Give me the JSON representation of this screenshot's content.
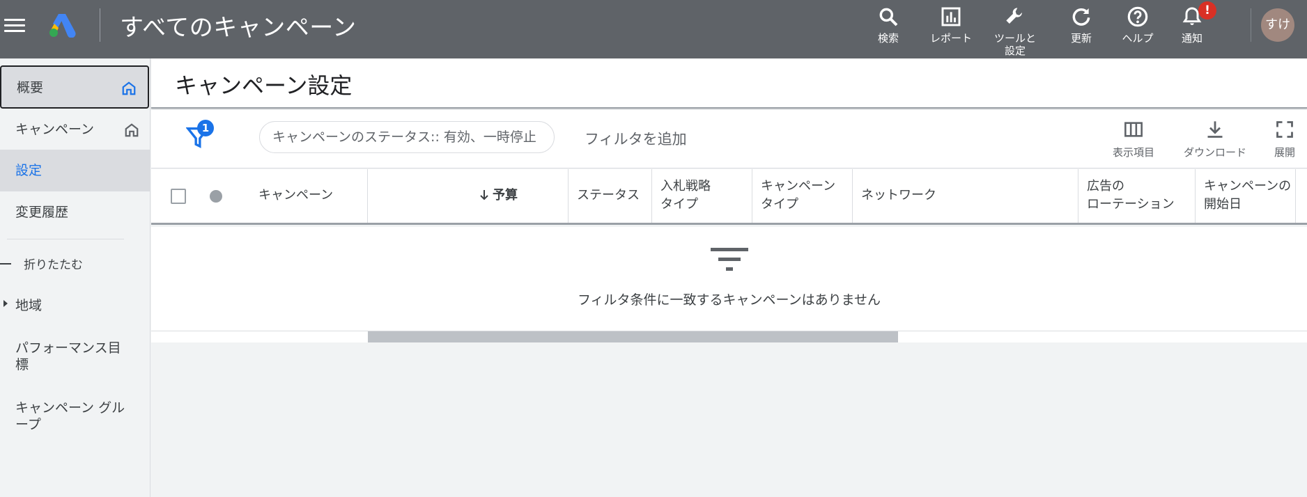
{
  "header": {
    "title": "すべてのキャンペーン",
    "actions": [
      {
        "icon": "search-icon",
        "label": "検索"
      },
      {
        "icon": "report-icon",
        "label": "レポート"
      },
      {
        "icon": "wrench-icon",
        "label": "ツールと\n設定"
      },
      {
        "icon": "refresh-icon",
        "label": "更新"
      },
      {
        "icon": "help-icon",
        "label": "ヘルプ"
      },
      {
        "icon": "bell-icon",
        "label": "通知"
      }
    ],
    "notification_badge": "!",
    "avatar_text": "すけ"
  },
  "sidebar": {
    "items": [
      {
        "label": "概要"
      },
      {
        "label": "キャンペーン"
      },
      {
        "label": "設定"
      },
      {
        "label": "変更履歴"
      }
    ],
    "collapse_label": "折りたたむ",
    "region_label": "地域",
    "performance_label": "パフォーマンス目標",
    "campaign_group_label": "キャンペーン グループ"
  },
  "page": {
    "title": "キャンペーン設定"
  },
  "toolbar": {
    "filter_count": "1",
    "filter_chip": "キャンペーンのステータス:: 有効、一時停止",
    "add_filter": "フィルタを追加",
    "columns_label": "表示項目",
    "download_label": "ダウンロード",
    "expand_label": "展開"
  },
  "table": {
    "columns": [
      "キャンペーン",
      "予算",
      "ステータス",
      "入札戦略\nタイプ",
      "キャンペーン\nタイプ",
      "ネットワーク",
      "広告の\nローテーション",
      "キャンペーンの\n開始日"
    ],
    "empty_message": "フィルタ条件に一致するキャンペーンはありません"
  },
  "colors": {
    "topbar": "#5f6368",
    "accent": "#1a73e8",
    "alert": "#d93025"
  }
}
